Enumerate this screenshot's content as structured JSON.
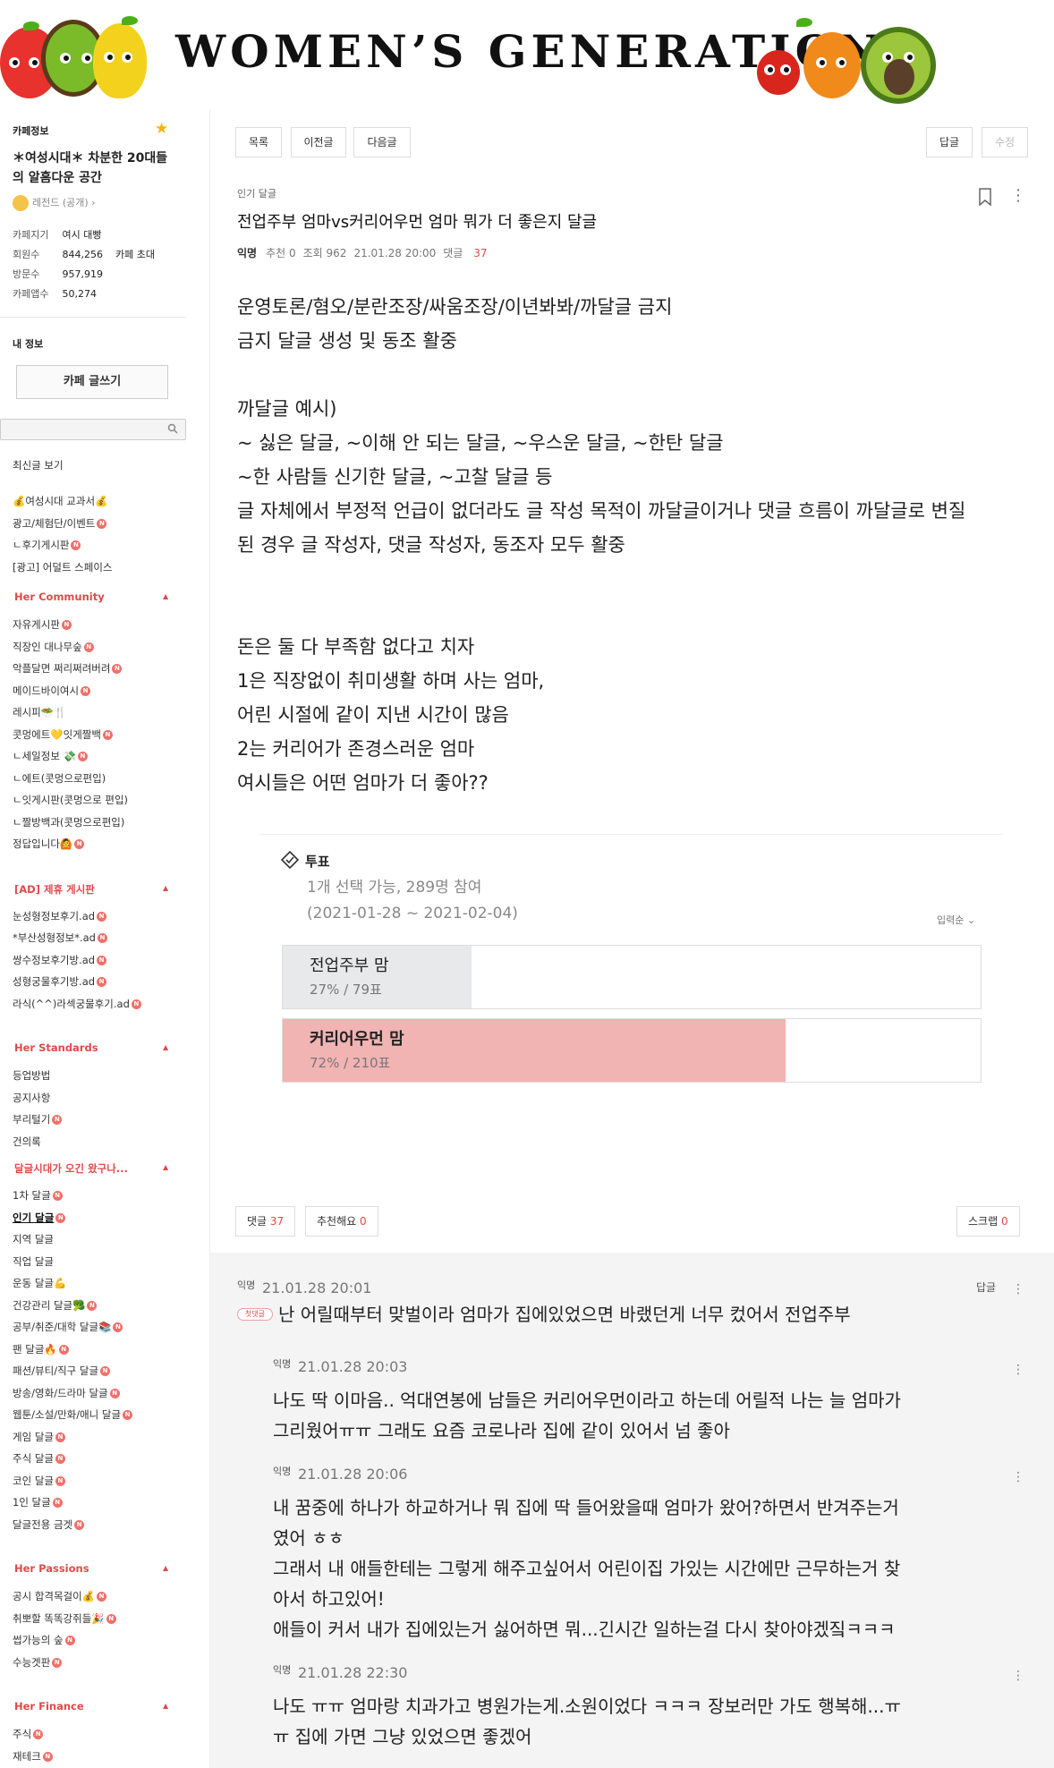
{
  "banner": {
    "title": "WOMEN’S GENERATION"
  },
  "sidebar": {
    "cafe_info_label": "카페정보",
    "cafe_name": "＊여성시대＊ 차분한 20대들의 알흠다운 공간",
    "level": "레전드 (공개)",
    "stats": [
      {
        "k": "카페지기",
        "v": "여시 대빵"
      },
      {
        "k": "회원수",
        "v": "844,256",
        "extra": "카페 초대"
      },
      {
        "k": "방문수",
        "v": "957,919"
      },
      {
        "k": "카페앱수",
        "v": "50,274"
      }
    ],
    "my_info_label": "내 정보",
    "write_button": "카페 글쓰기",
    "recent_label": "최신글 보기",
    "menu_top": [
      {
        "label": "💰여성시대 교과서💰",
        "badge": false
      },
      {
        "label": "광고/체험단/이벤트",
        "badge": true
      },
      {
        "label": "ㄴ후기게시판",
        "badge": true
      },
      {
        "label": "[광고] 어덜트 스페이스",
        "badge": false
      }
    ],
    "cat_community": "Her Community",
    "menu_community": [
      {
        "label": "자유게시판",
        "badge": true
      },
      {
        "label": "직장인 대나무숲",
        "badge": true
      },
      {
        "label": "악플달면 쩌리쩌려버려",
        "badge": true
      },
      {
        "label": "메이드바이여시",
        "badge": true
      },
      {
        "label": "레시피🥗🍴",
        "badge": false
      },
      {
        "label": "콧멍에트💛잇게짤백",
        "badge": true
      },
      {
        "label": "ㄴ세일정보 💸",
        "badge": true
      },
      {
        "label": "ㄴ에트(콧멍으로편입)",
        "badge": false
      },
      {
        "label": "ㄴ잇게시판(콧멍으로 편입)",
        "badge": false
      },
      {
        "label": "ㄴ짤방백과(콧멍으로편입)",
        "badge": false
      },
      {
        "label": "정답입니다🙆",
        "badge": true
      }
    ],
    "cat_ad": "[AD] 제휴 게시판",
    "menu_ad": [
      {
        "label": "눈성형정보후기.ad",
        "badge": true
      },
      {
        "label": "*부산성형정보*.ad",
        "badge": true
      },
      {
        "label": "쌍수정보후기방.ad",
        "badge": true
      },
      {
        "label": "성형궁물후기방.ad",
        "badge": true
      },
      {
        "label": "라식(^^)라섹궁물후기.ad",
        "badge": true
      }
    ],
    "cat_standards": "Her Standards",
    "menu_standards": [
      {
        "label": "등업방법",
        "badge": false
      },
      {
        "label": "공지사항",
        "badge": false
      },
      {
        "label": "부리털기",
        "badge": true
      },
      {
        "label": "건의록",
        "badge": false
      }
    ],
    "cat_dalgeul": "달글시대가 오긴 왔구나...",
    "menu_dalgeul": [
      {
        "label": "1차 달글",
        "badge": true,
        "active": false
      },
      {
        "label": "인기 달글",
        "badge": true,
        "active": true
      },
      {
        "label": "지역 달글",
        "badge": false,
        "active": false
      },
      {
        "label": "직업 달글",
        "badge": false,
        "active": false
      },
      {
        "label": "운동 달글💪",
        "badge": false,
        "active": false
      },
      {
        "label": "건강관리 달글🥦",
        "badge": true,
        "active": false
      },
      {
        "label": "공부/취준/대학 달글📚",
        "badge": true,
        "active": false
      },
      {
        "label": "팬 달글🔥",
        "badge": true,
        "active": false
      },
      {
        "label": "패션/뷰티/직구 달글",
        "badge": true,
        "active": false
      },
      {
        "label": "방송/영화/드라마 달글",
        "badge": true,
        "active": false
      },
      {
        "label": "웹툰/소설/만화/애니 달글",
        "badge": true,
        "active": false
      },
      {
        "label": "게임 달글",
        "badge": true,
        "active": false
      },
      {
        "label": "주식 달글",
        "badge": true,
        "active": false
      },
      {
        "label": "코인 달글",
        "badge": true,
        "active": false
      },
      {
        "label": "1인 달글",
        "badge": true,
        "active": false
      },
      {
        "label": "달글전용 금겟",
        "badge": true,
        "active": false
      }
    ],
    "cat_passions": "Her Passions",
    "menu_passions": [
      {
        "label": "공시 합격목걸이💰",
        "badge": true
      },
      {
        "label": "취뽀할 똑똑강쥐들🎉",
        "badge": true
      },
      {
        "label": "썹가능의 숲",
        "badge": true
      },
      {
        "label": "수능겟판",
        "badge": true
      }
    ],
    "cat_finance": "Her Finance",
    "menu_finance": [
      {
        "label": "주식",
        "badge": true
      },
      {
        "label": "재테크",
        "badge": true
      },
      {
        "label": "금전거래전용게시판",
        "badge": true
      }
    ]
  },
  "toolbar": {
    "list": "목록",
    "prev": "이전글",
    "next": "다음글",
    "reply": "답글",
    "edit": "수정"
  },
  "post": {
    "board": "인기 달글",
    "title": "전업주부 엄마vs커리어우먼 엄마 뭐가 더 좋은지 달글",
    "author": "익명",
    "recommend": "추천 0",
    "views": "조회 962",
    "date": "21.01.28 20:00",
    "comments_label": "댓글",
    "comments_count": "37",
    "body": [
      "운영토론/혐오/분란조장/싸움조장/이년봐봐/까달글 금지",
      "금지 달글 생성 및 동조 활중",
      "",
      "까달글 예시)",
      "~ 싫은 달글, ~이해 안 되는 달글, ~우스운 달글, ~한탄 달글",
      "~한 사람들 신기한 달글, ~고찰 달글 등",
      "글 자체에서 부정적 언급이 없더라도 글 작성 목적이 까달글이거나 댓글 흐름이 까달글로 변질",
      "된 경우 글 작성자, 댓글 작성자, 동조자 모두 활중",
      "",
      "",
      "돈은 둘 다 부족함 없다고 치자",
      "1은 직장없이 취미생활 하며 사는 엄마,",
      "어린 시절에 같이 지낸 시간이 많음",
      "2는 커리어가 존경스러운 엄마",
      "여시들은 어떤 엄마가 더 좋아??"
    ]
  },
  "poll": {
    "title": "투표",
    "desc1": "1개 선택 가능, 289명 참여",
    "desc2": "(2021-01-28 ~ 2021-02-04)",
    "sort": "입력순 ⌄",
    "options": [
      {
        "label": "전업주부 맘",
        "stat": "27% / 79표",
        "percent": 27,
        "color": "#e8e9eb",
        "bold": false
      },
      {
        "label": "커리어우먼 맘",
        "stat": "72% / 210표",
        "percent": 72,
        "color": "#f2b3b3",
        "bold": true
      }
    ]
  },
  "actions": {
    "comments_label": "댓글",
    "comments_count": "37",
    "recommend_label": "추천해요",
    "recommend_count": "0",
    "scrap_label": "스크랩",
    "scrap_count": "0"
  },
  "comments": [
    {
      "author": "익명",
      "time": "21.01.28 20:01",
      "badge": "첫댓글",
      "reply": "답글",
      "lines": [
        "난 어릴때부터 맞벌이라 엄마가 집에있었으면 바랬던게 너무 컸어서 전업주부"
      ]
    },
    {
      "author": "익명",
      "time": "21.01.28 20:03",
      "lines": [
        "나도 딱 이마음.. 억대연봉에 남들은 커리어우먼이라고 하는데 어릴적 나는 늘 엄마가",
        "그리웠어ㅠㅠ 그래도 요즘 코로나라 집에 같이 있어서 넘 좋아"
      ]
    },
    {
      "author": "익명",
      "time": "21.01.28 20:06",
      "lines": [
        "내 꿈중에 하나가 하교하거나 뭐 집에 딱 들어왔을때 엄마가 왔어?하면서 반겨주는거",
        "였어 ㅎㅎ",
        "그래서 내 애들한테는 그렇게 해주고싶어서 어린이집 가있는 시간에만 근무하는거 찾",
        "아서 하고있어!",
        "애들이 커서 내가 집에있는거 싫어하면 뭐...긴시간 일하는걸 다시 찾아야겠짘ㅋㅋㅋ"
      ]
    },
    {
      "author": "익명",
      "time": "21.01.28 22:30",
      "lines": [
        "나도 ㅠㅠ 엄마랑 치과가고 병원가는게.소원이었다 ㅋㅋㅋ 장보러만 가도 행복해...ㅠ",
        "ㅠ 집에 가면 그냥 있었으면 좋겠어"
      ]
    }
  ]
}
